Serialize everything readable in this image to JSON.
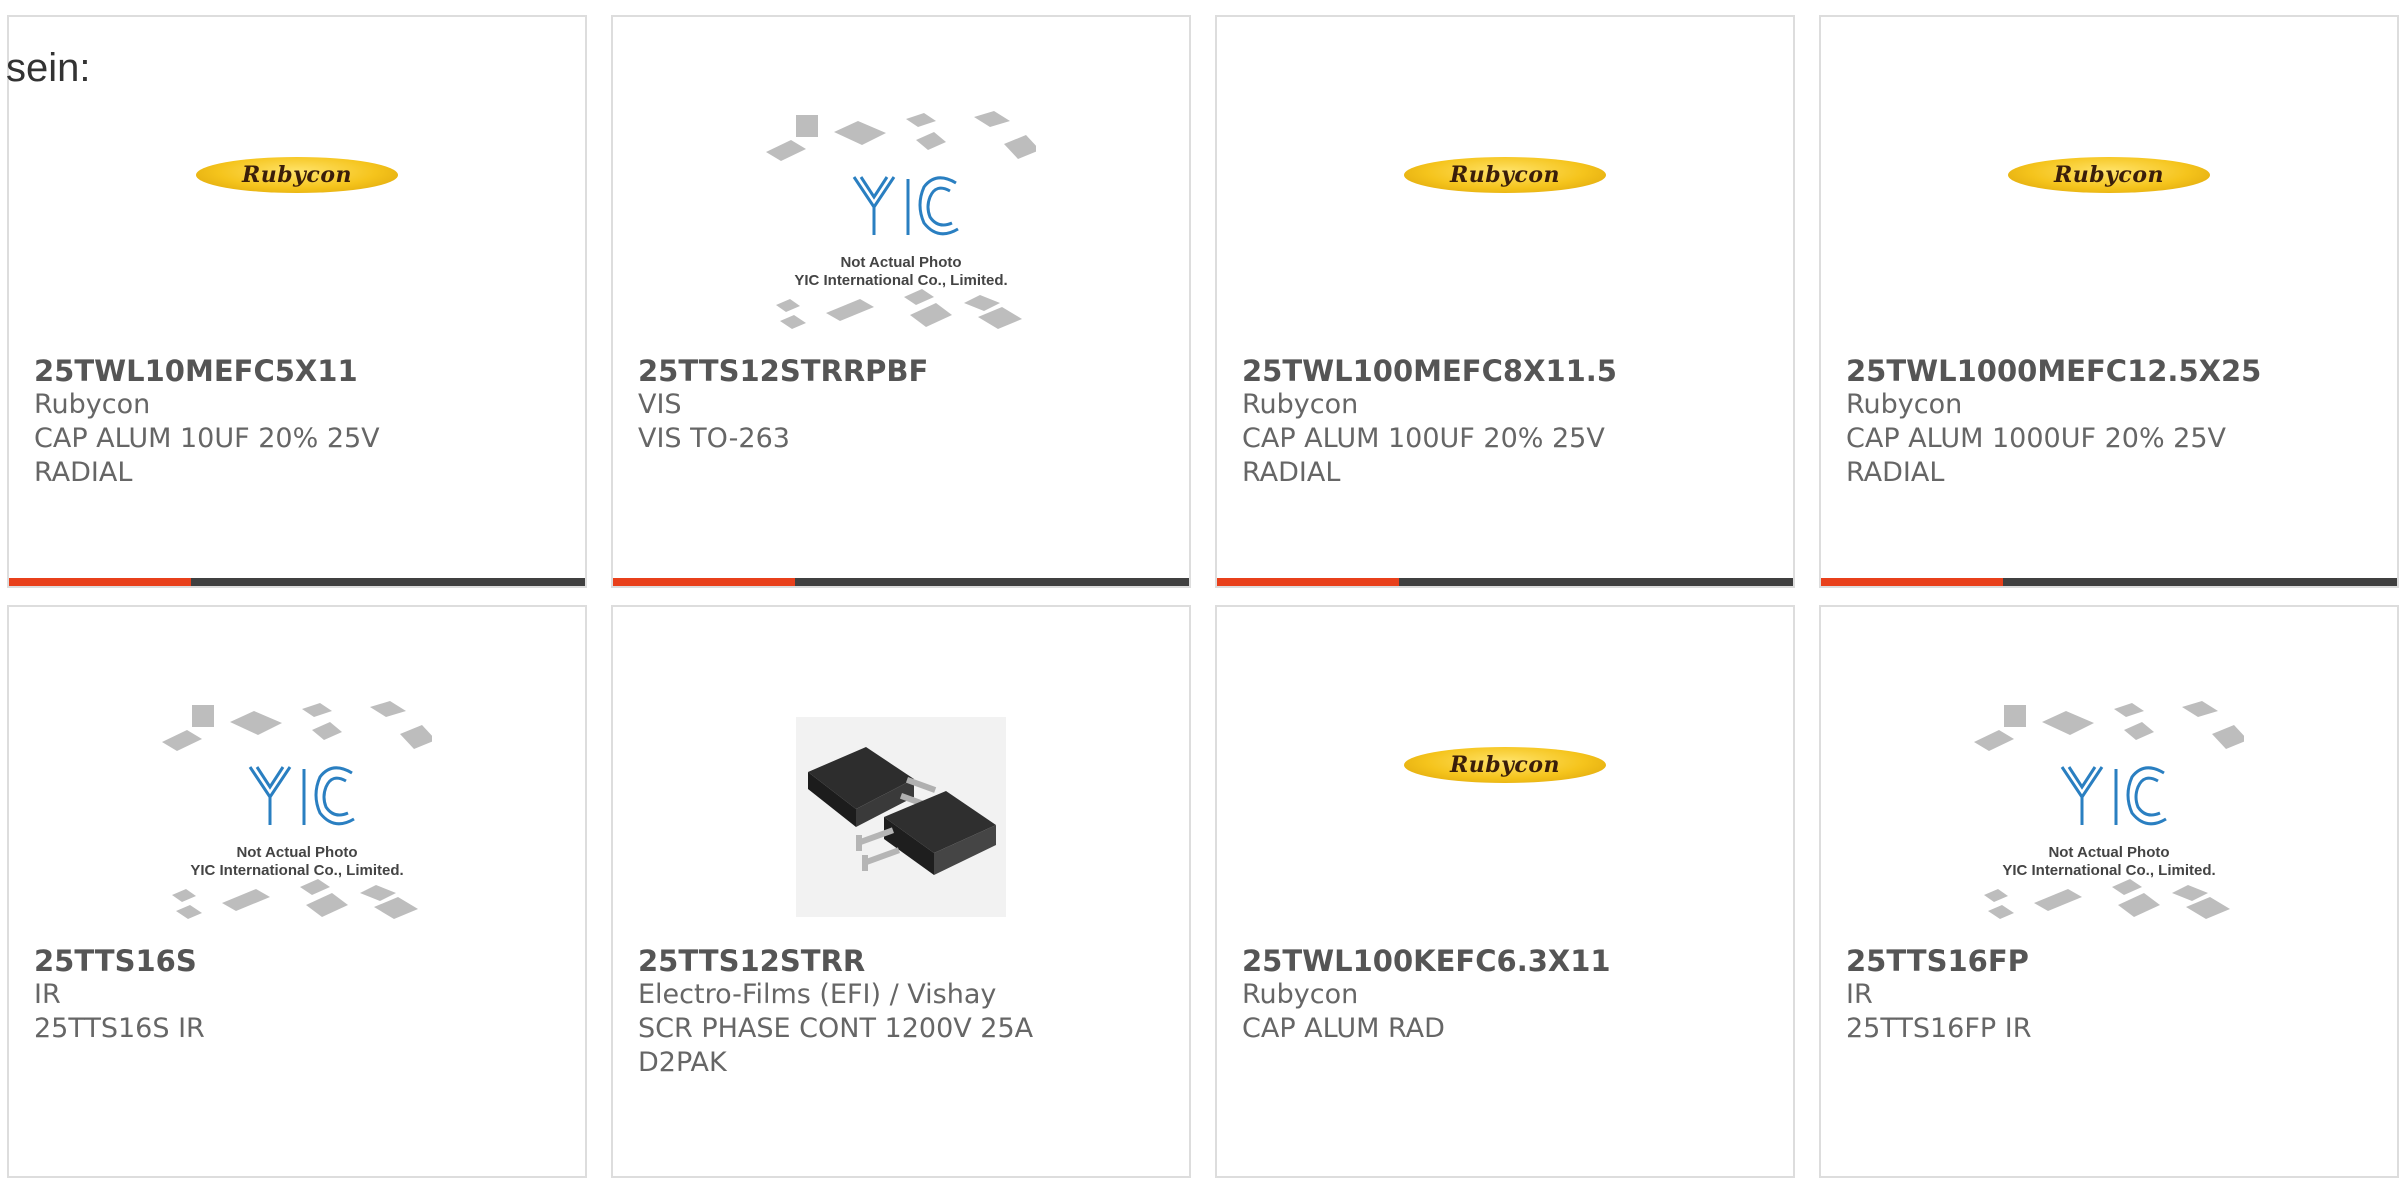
{
  "lead_text": "sein:",
  "placeholder": {
    "logo_text": "YIC",
    "line1": "Not Actual Photo",
    "line2": "YIC International Co., Limited."
  },
  "products": [
    {
      "part": "25TWL10MEFC5X11",
      "maker": "Rubycon",
      "desc": "CAP ALUM 10UF 20% 25V",
      "desc2": "RADIAL",
      "image": "rubycon-logo",
      "logo_text": "Rubycon"
    },
    {
      "part": "25TTS12STRRPBF",
      "maker": "VIS",
      "desc": "VIS TO-263",
      "desc2": "",
      "image": "yic-placeholder"
    },
    {
      "part": "25TWL100MEFC8X11.5",
      "maker": "Rubycon",
      "desc": "CAP ALUM 100UF 20% 25V",
      "desc2": "RADIAL",
      "image": "rubycon-logo",
      "logo_text": "Rubycon"
    },
    {
      "part": "25TWL1000MEFC12.5X25",
      "maker": "Rubycon",
      "desc": "CAP ALUM 1000UF 20% 25V",
      "desc2": "RADIAL",
      "image": "rubycon-logo",
      "logo_text": "Rubycon"
    },
    {
      "part": "25TTS16S",
      "maker": "IR",
      "desc": "25TTS16S IR",
      "desc2": "",
      "image": "yic-placeholder"
    },
    {
      "part": "25TTS12STRR",
      "maker": "Electro-Films (EFI) / Vishay",
      "desc": "SCR PHASE CONT 1200V 25A",
      "desc2": "D2PAK",
      "image": "d2pak-photo"
    },
    {
      "part": "25TWL100KEFC6.3X11",
      "maker": "Rubycon",
      "desc": "CAP ALUM RAD",
      "desc2": "",
      "image": "rubycon-logo",
      "logo_text": "Rubycon"
    },
    {
      "part": "25TTS16FP",
      "maker": "IR",
      "desc": "25TTS16FP IR",
      "desc2": "",
      "image": "yic-placeholder"
    }
  ],
  "colors": {
    "accent": "#e8401b",
    "bar": "#404040",
    "border": "#dddddd",
    "text": "#555555"
  }
}
